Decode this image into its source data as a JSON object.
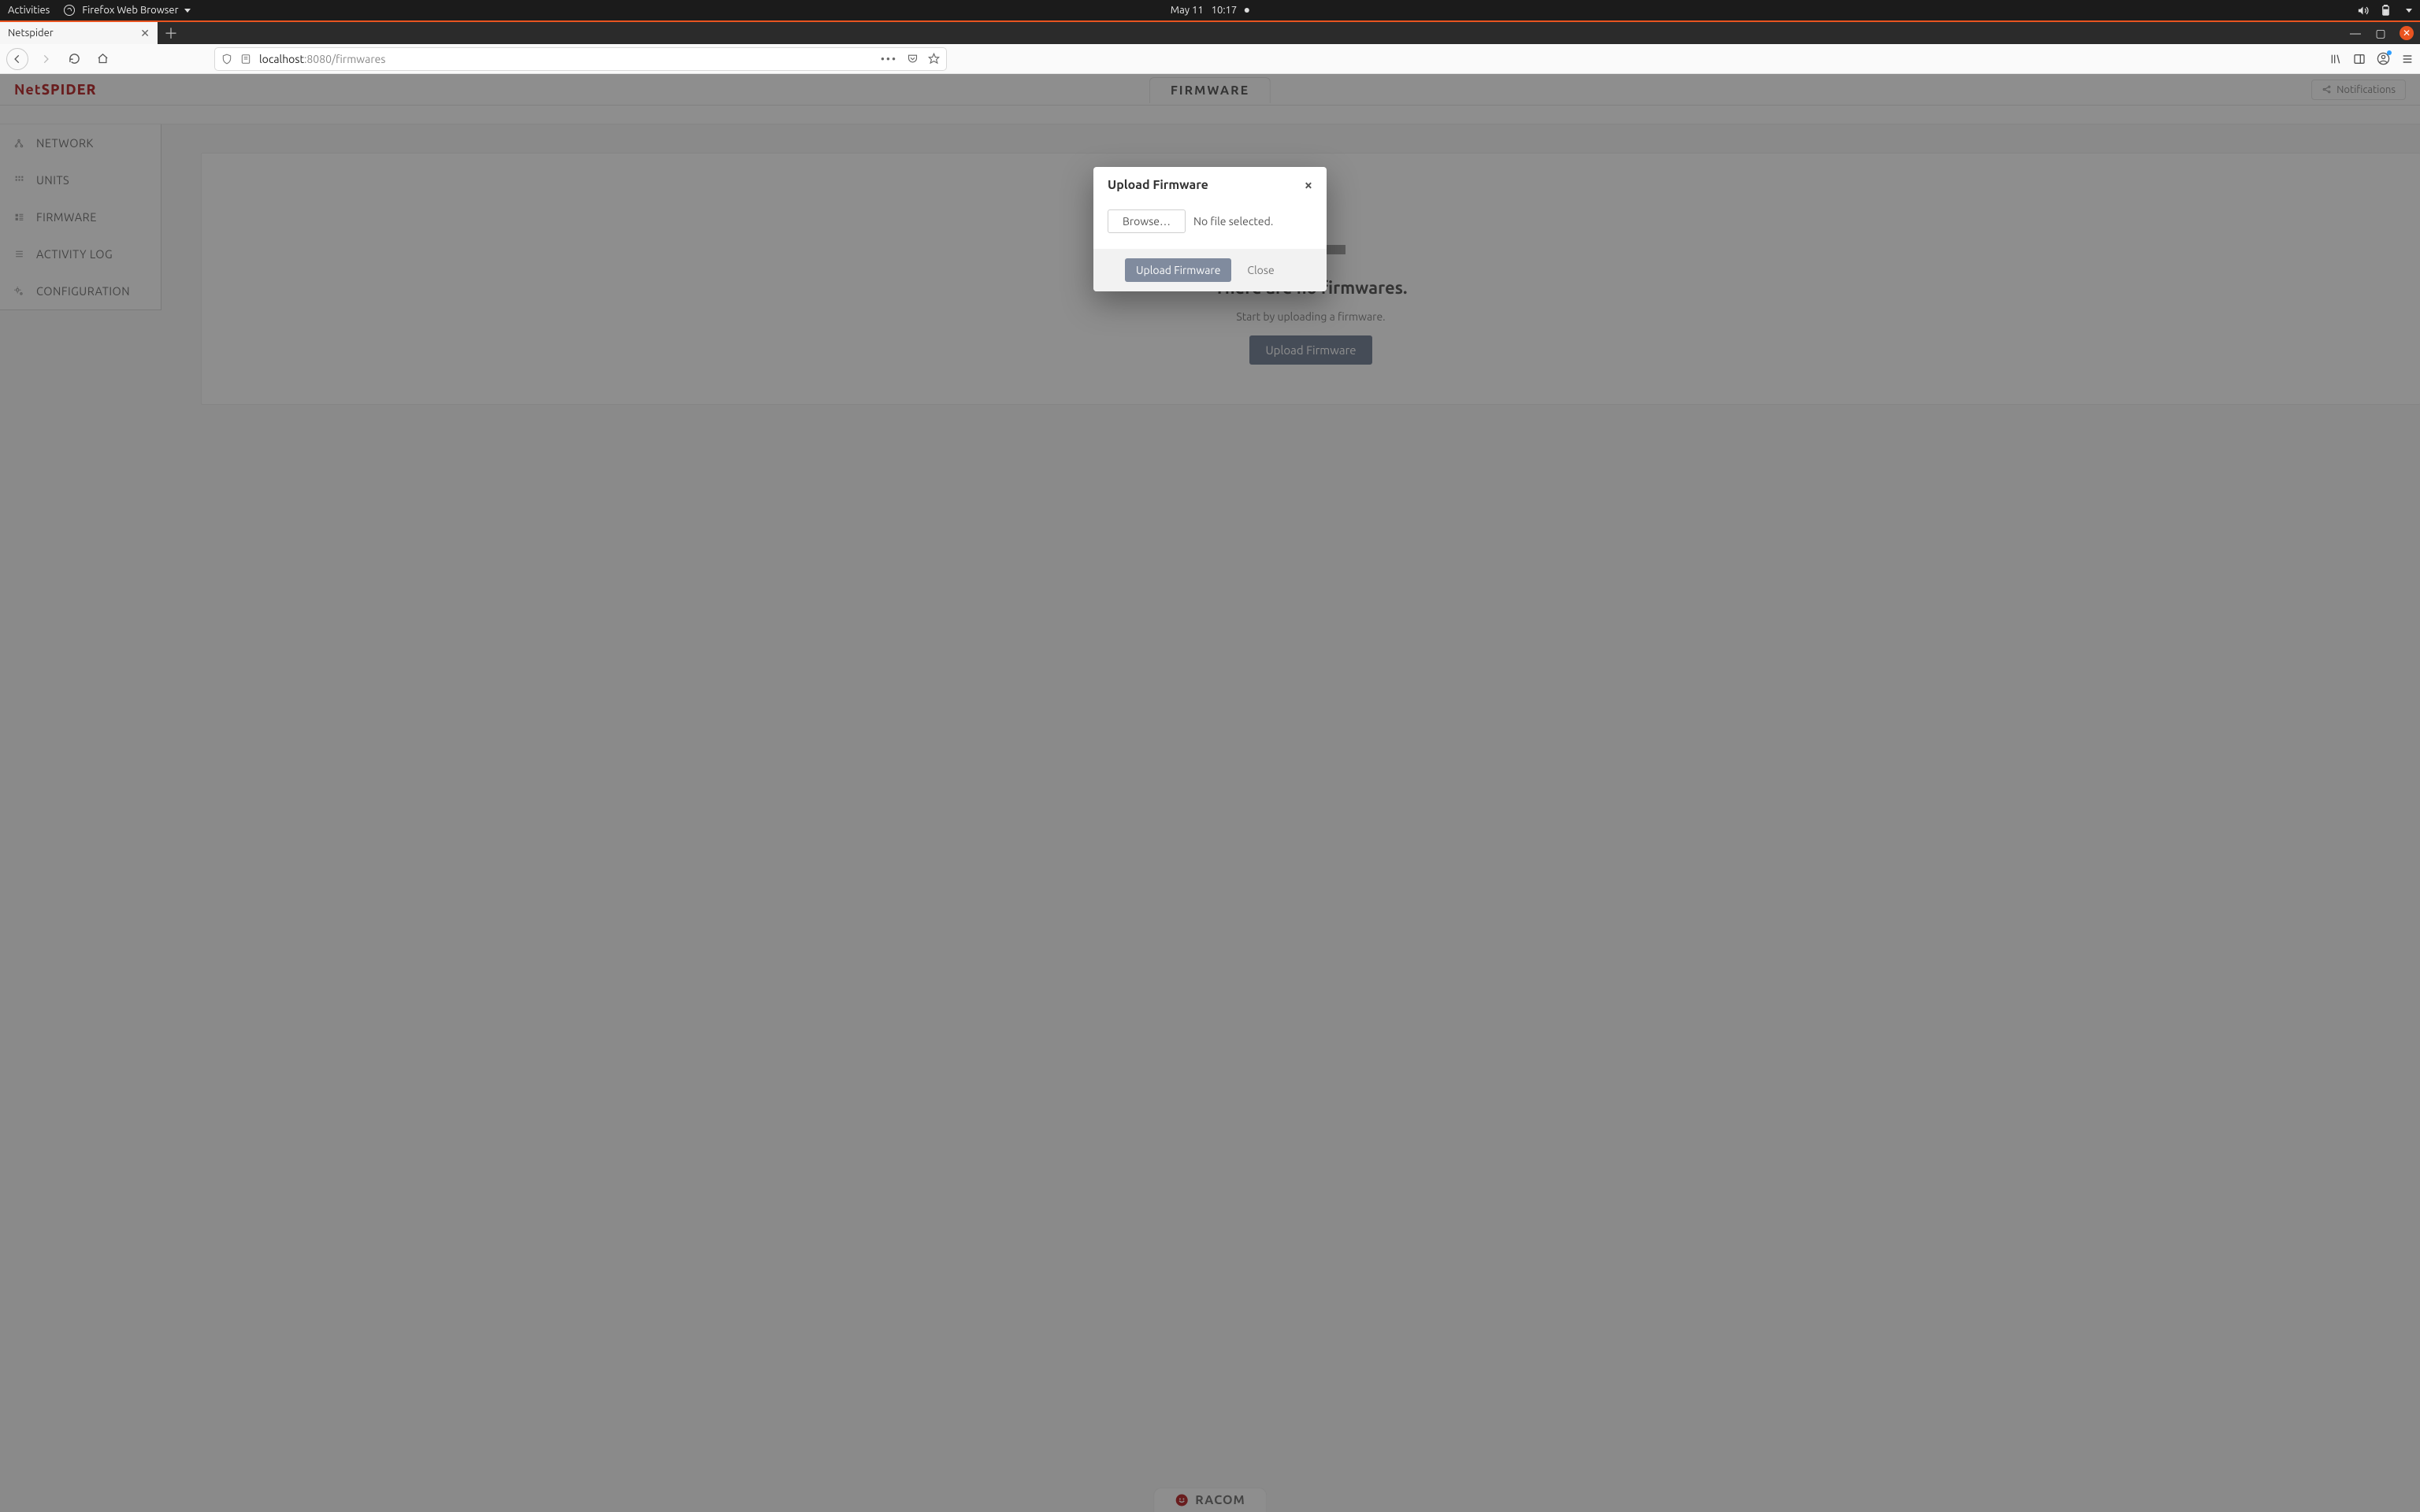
{
  "gnome": {
    "activities": "Activities",
    "app_label": "Firefox Web Browser",
    "date": "May 11",
    "time": "10:17"
  },
  "browser": {
    "tab_title": "Netspider",
    "url_host": "localhost",
    "url_port_path": ":8080/firmwares"
  },
  "app": {
    "brand_a": "Net",
    "brand_b": "SPIDER",
    "header_tab": "FIRMWARE",
    "notifications_label": "Notifications"
  },
  "sidebar": {
    "items": [
      {
        "label": "NETWORK"
      },
      {
        "label": "UNITS"
      },
      {
        "label": "FIRMWARE"
      },
      {
        "label": "ACTIVITY LOG"
      },
      {
        "label": "CONFIGURATION"
      }
    ]
  },
  "empty": {
    "heading": "There are no firmwares.",
    "sub": "Start by uploading a firmware.",
    "cta": "Upload Firmware"
  },
  "modal": {
    "title": "Upload Firmware",
    "browse": "Browse…",
    "file_status": "No file selected.",
    "confirm": "Upload Firmware",
    "close": "Close"
  },
  "footer": {
    "logo_text": "RACOM"
  }
}
